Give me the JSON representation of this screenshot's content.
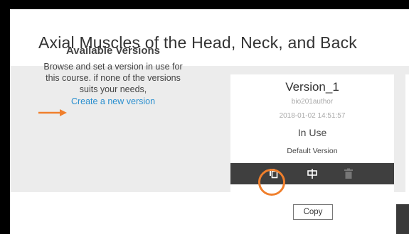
{
  "page": {
    "title": "Axial Muscles of the Head, Neck, and Back"
  },
  "available_versions": {
    "heading": "Available Versions",
    "description": "Browse and set a version in use for this course. if none of the versions suits your needs,",
    "create_link": "Create a new version"
  },
  "version_card": {
    "name": "Version_1",
    "author": "bio201author",
    "date": "2018-01-02 14:51:57",
    "status": "In Use",
    "default_label": "Default Version",
    "actions": [
      {
        "icon": "copy-icon"
      },
      {
        "icon": "edit-icon"
      },
      {
        "icon": "trash-icon"
      }
    ]
  },
  "tooltip": {
    "text": "Copy"
  },
  "colors": {
    "accent": "#f07f2c",
    "link": "#2a8fcf",
    "toolbar": "#3f3f3f",
    "panel": "#ececec"
  }
}
